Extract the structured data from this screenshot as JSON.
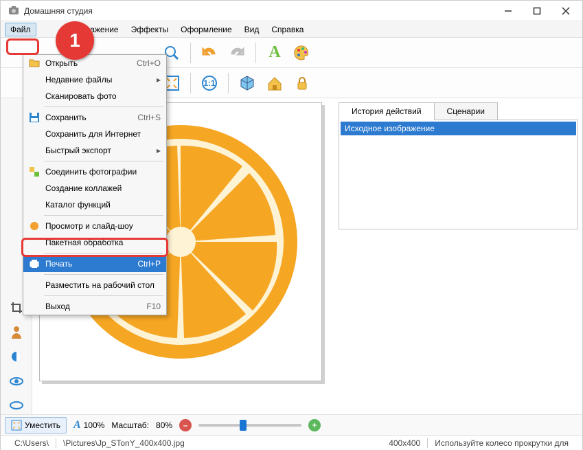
{
  "window": {
    "title": "Домашняя      студия"
  },
  "badge": {
    "number": "1"
  },
  "menu": {
    "file": "Файл",
    "image": "ражение",
    "effects": "Эффекты",
    "design": "Оформление",
    "view": "Вид",
    "help": "Справка"
  },
  "file_menu": {
    "open": {
      "label": "Открыть",
      "shortcut": "Ctrl+O"
    },
    "recent": {
      "label": "Недавние файлы"
    },
    "scan": {
      "label": "Сканировать фото"
    },
    "save": {
      "label": "Сохранить",
      "shortcut": "Ctrl+S"
    },
    "save_web": {
      "label": "Сохранить для Интернет"
    },
    "quick_export": {
      "label": "Быстрый экспорт"
    },
    "merge": {
      "label": "Соединить фотографии"
    },
    "collage": {
      "label": "Создание коллажей"
    },
    "catalog": {
      "label": "Каталог функций"
    },
    "slideshow": {
      "label": "Просмотр и слайд-шоу"
    },
    "batch": {
      "label": "Пакетная обработка"
    },
    "print": {
      "label": "Печать",
      "shortcut": "Ctrl+P"
    },
    "wallpaper": {
      "label": "Разместить на рабочий стол"
    },
    "exit": {
      "label": "Выход",
      "shortcut": "F10"
    }
  },
  "right_panel": {
    "tab_history": "История действий",
    "tab_scenarios": "Сценарии",
    "history_item": "Исходное изображение"
  },
  "status": {
    "fit": "Уместить",
    "text_zoom": "100%",
    "scale_label": "Масштаб:",
    "scale_value": "80%"
  },
  "statusbar": {
    "path_prefix": "C:\\Users\\",
    "file": "\\Pictures\\Jp_STonY_400x400.jpg",
    "dims": "400x400",
    "hint": "Используйте колесо прокрутки для"
  },
  "toolbar_icons": {
    "undo": "undo",
    "redo": "redo",
    "text": "A",
    "palette": "palette",
    "fit": "fit",
    "ratio11": "1:1",
    "box": "box",
    "home": "home",
    "lock": "lock"
  }
}
